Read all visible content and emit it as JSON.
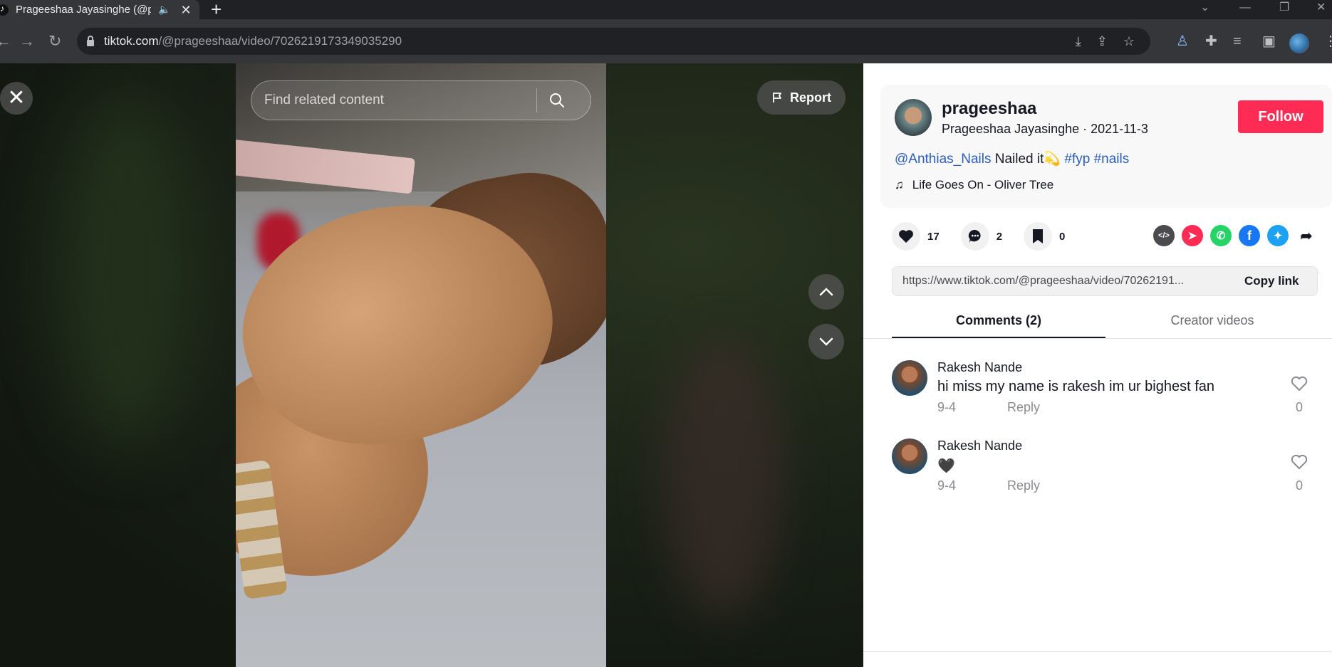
{
  "browser": {
    "tab_title": "Prageeshaa Jayasinghe (@pr",
    "url_domain": "tiktok.com",
    "url_path": "/@prageeshaa/video/7026219173349035290"
  },
  "video": {
    "search_placeholder": "Find related content",
    "report_label": "Report"
  },
  "author": {
    "username": "prageeshaa",
    "display_name": "Prageeshaa Jayasinghe",
    "date": "2021-11-3",
    "follow_label": "Follow"
  },
  "caption": {
    "mention": "@Anthias_Nails",
    "text": "Nailed it",
    "emoji": "💫",
    "hashtag1": "#fyp",
    "hashtag2": "#nails"
  },
  "music": "Life Goes On - Oliver Tree",
  "stats": {
    "likes": "17",
    "comments": "2",
    "saves": "0"
  },
  "share": {
    "link": "https://www.tiktok.com/@prageeshaa/video/70262191...",
    "copy_label": "Copy link"
  },
  "tabs": {
    "comments": "Comments (2)",
    "creator_videos": "Creator videos"
  },
  "comments": [
    {
      "name": "Rakesh Nande",
      "text": "hi miss my name is rakesh im ur bighest fan",
      "date": "9-4",
      "reply": "Reply",
      "likes": "0"
    },
    {
      "name": "Rakesh Nande",
      "text": "🖤",
      "date": "9-4",
      "reply": "Reply",
      "likes": "0"
    }
  ],
  "colors": {
    "follow": "#fe2c55",
    "link": "#2b5db9",
    "whatsapp": "#25d366",
    "facebook": "#1877f2",
    "twitter": "#1da1f2",
    "telegram_send": "#fe2c55",
    "embed": "#4a4a4f"
  }
}
